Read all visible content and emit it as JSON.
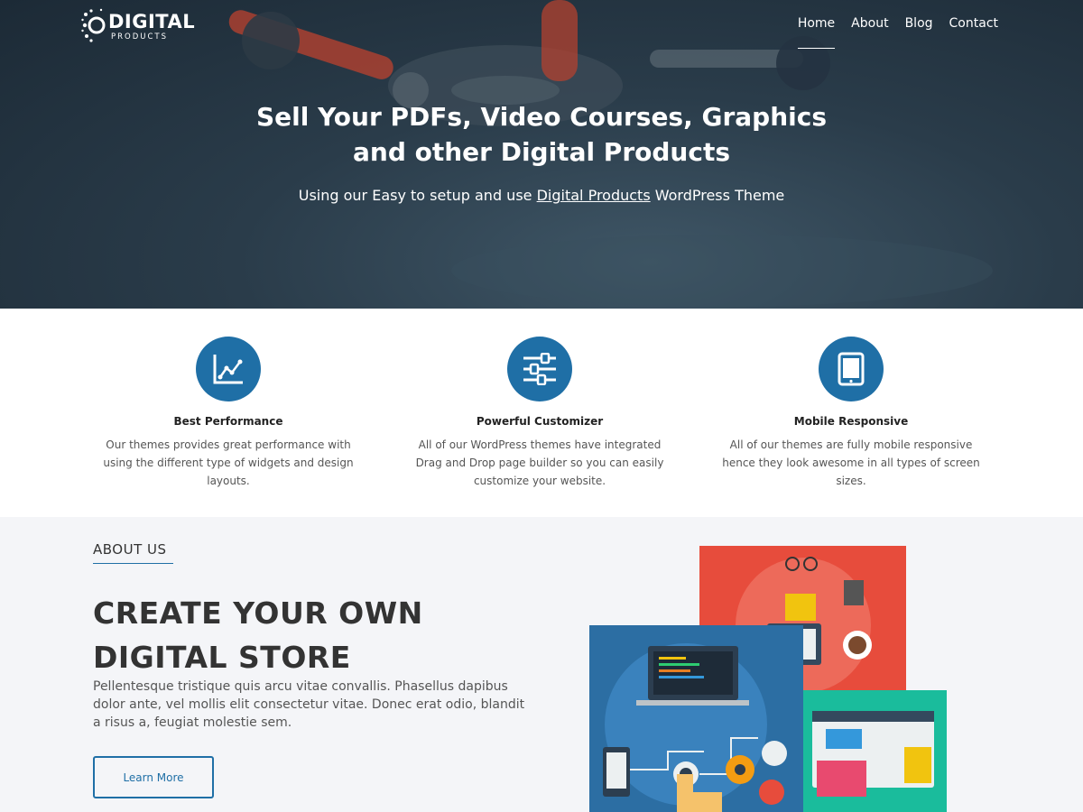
{
  "brand": {
    "name_line1": "DIGITAL",
    "name_line2": "PRODUCTS"
  },
  "nav": {
    "items": [
      {
        "label": "Home",
        "active": true
      },
      {
        "label": "About",
        "active": false
      },
      {
        "label": "Blog",
        "active": false
      },
      {
        "label": "Contact",
        "active": false
      }
    ]
  },
  "hero": {
    "title_line1": "Sell Your PDFs, Video Courses, Graphics",
    "title_line2": "and other Digital Products",
    "subtitle_before": "Using our Easy to setup and use ",
    "subtitle_link": "Digital Products",
    "subtitle_after": " WordPress Theme"
  },
  "features": [
    {
      "icon": "chart-icon",
      "title": "Best Performance",
      "text": "Our themes provides great performance with using the different type of widgets and design layouts."
    },
    {
      "icon": "sliders-icon",
      "title": "Powerful Customizer",
      "text": "All of our WordPress themes have integrated Drag and Drop page builder so you can easily customize your website."
    },
    {
      "icon": "tablet-icon",
      "title": "Mobile Responsive",
      "text": "All of our themes are fully mobile responsive hence they look awesome in all types of screen sizes."
    }
  ],
  "about": {
    "label": "ABOUT US",
    "heading": "CREATE YOUR OWN DIGITAL STORE",
    "text": "Pellentesque tristique quis arcu vitae convallis. Phasellus dapibus dolor ante, vel mollis elit consectetur vitae. Donec erat odio, blandit a risus a, feugiat molestie sem.",
    "button_label": "Learn More"
  },
  "colors": {
    "accent": "#1f6fa6",
    "hero_bg": "#2a3c4a",
    "about_bg": "#f4f5f8"
  }
}
